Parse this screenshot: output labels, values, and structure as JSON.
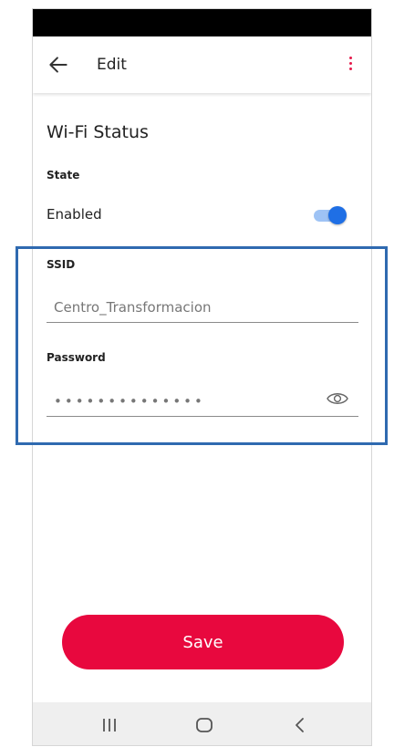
{
  "appbar": {
    "title": "Edit"
  },
  "wifi": {
    "section_title": "Wi-Fi Status",
    "state_label": "State",
    "state_value": "Enabled",
    "enabled": true,
    "ssid_label": "SSID",
    "ssid_value": "Centro_Transformacion",
    "password_label": "Password",
    "password_value": "••••••••••••••"
  },
  "actions": {
    "save_label": "Save"
  },
  "icons": {
    "back": "back-arrow-icon",
    "more": "more-vert-icon",
    "visibility": "eye-icon",
    "nav_recents": "recents-icon",
    "nav_home": "home-icon",
    "nav_back": "nav-back-icon"
  },
  "colors": {
    "accent": "#e8083e",
    "toggle_on": "#1f6fe5",
    "highlight": "#2f6ab0"
  }
}
